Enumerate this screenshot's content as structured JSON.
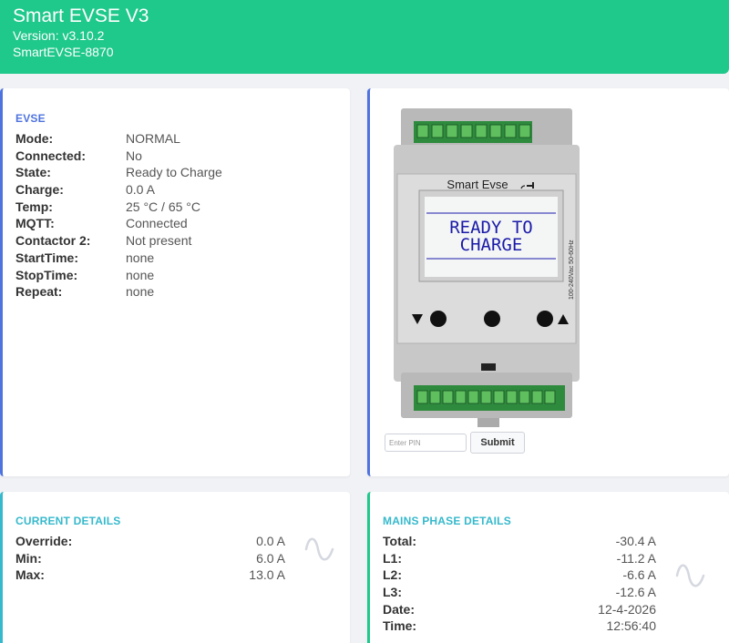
{
  "header": {
    "title": "Smart EVSE V3",
    "version": "Version: v3.10.2",
    "device_id": "SmartEVSE-8870"
  },
  "evse": {
    "title": "EVSE",
    "rows": [
      {
        "label": "Mode:",
        "value": "NORMAL"
      },
      {
        "label": "Connected:",
        "value": "No"
      },
      {
        "label": "State:",
        "value": "Ready to Charge"
      },
      {
        "label": "Charge:",
        "value": "0.0 A"
      },
      {
        "label": "Temp:",
        "value": "25 °C / 65 °C"
      },
      {
        "label": "MQTT:",
        "value": "Connected"
      },
      {
        "label": "Contactor 2:",
        "value": "Not present"
      },
      {
        "label": "StartTime:",
        "value": "none"
      },
      {
        "label": "StopTime:",
        "value": "none"
      },
      {
        "label": "Repeat:",
        "value": "none"
      }
    ]
  },
  "device": {
    "brand": "Smart Evse",
    "lcd_line1": "READY TO",
    "lcd_line2": "CHARGE",
    "side_label": "100-240Vac 50-60Hz"
  },
  "pin": {
    "placeholder": "Enter PIN",
    "submit_label": "Submit"
  },
  "current": {
    "title": "CURRENT DETAILS",
    "rows": [
      {
        "label": "Override:",
        "value": "0.0 A"
      },
      {
        "label": "Min:",
        "value": "6.0 A"
      },
      {
        "label": "Max:",
        "value": "13.0 A"
      }
    ],
    "icon": "sine-wave-icon"
  },
  "mains": {
    "title": "MAINS PHASE DETAILS",
    "rows": [
      {
        "label": "Total:",
        "value": "-30.4 A"
      },
      {
        "label": "L1:",
        "value": "-11.2 A"
      },
      {
        "label": "L2:",
        "value": "-6.6 A"
      },
      {
        "label": "L3:",
        "value": "-12.6 A"
      },
      {
        "label": "Date:",
        "value": "12-4-2026"
      },
      {
        "label": "Time:",
        "value": "12:56:40"
      }
    ],
    "icon": "sine-wave-icon"
  },
  "colors": {
    "header": "#1fc88b",
    "primary": "#4e73df",
    "info": "#36b9cc",
    "success": "#1fc88b",
    "lcd_text": "#1a1aa8"
  }
}
